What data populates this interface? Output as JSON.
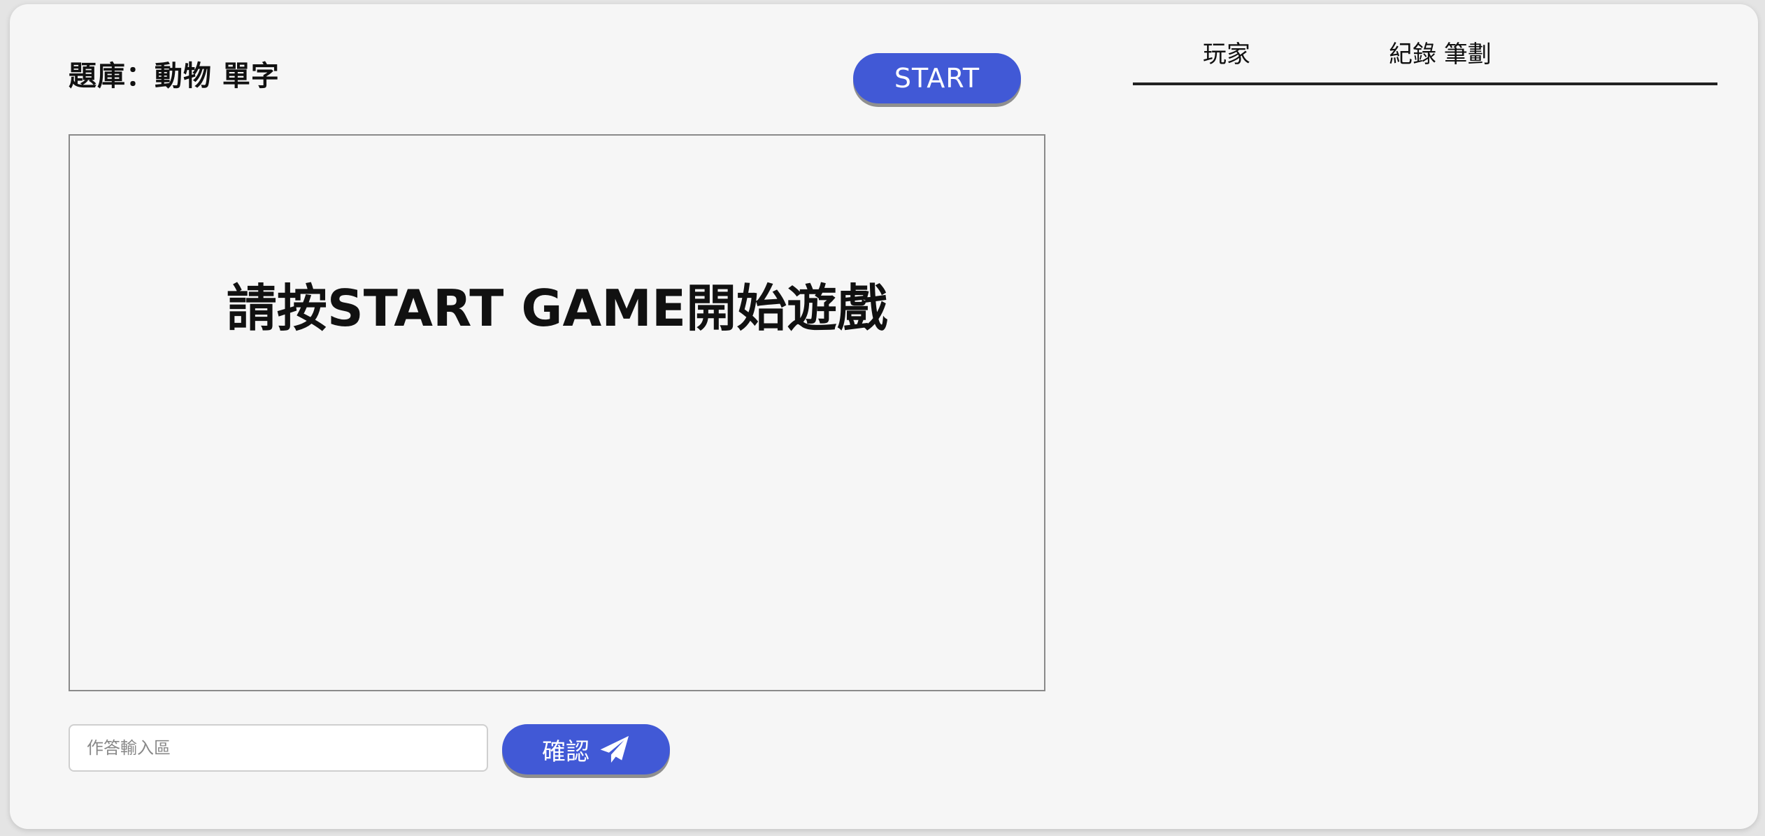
{
  "topic_label": "題庫：動物 單字",
  "start_button": {
    "label": "START"
  },
  "game_board": {
    "prompt": "請按START GAME開始遊戲"
  },
  "answer": {
    "placeholder": "作答輸入區",
    "value": ""
  },
  "confirm_button": {
    "label": "確認",
    "icon": "paper-plane-icon"
  },
  "scoreboard": {
    "columns": [
      {
        "label": "玩家"
      },
      {
        "label": "紀錄 筆劃"
      }
    ]
  },
  "colors": {
    "accent": "#4159d6",
    "background": "#f6f6f6",
    "text": "#111111"
  }
}
